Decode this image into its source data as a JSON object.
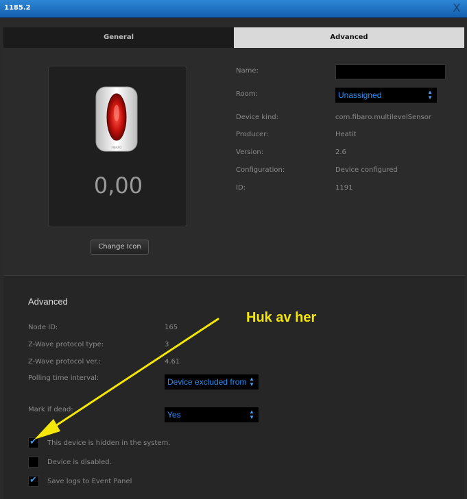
{
  "window": {
    "title": "1185.2",
    "close_glyph": "X"
  },
  "tabs": [
    {
      "label": "General",
      "active": false
    },
    {
      "label": "Advanced",
      "active": true
    }
  ],
  "device": {
    "value": "0,00",
    "brand_text": "FIBARO",
    "change_icon_label": "Change Icon"
  },
  "info": {
    "name_label": "Name:",
    "name_value": "",
    "room_label": "Room:",
    "room_value": "Unassigned",
    "device_kind_label": "Device kind:",
    "device_kind_value": "com.fibaro.multilevelSensor",
    "producer_label": "Producer:",
    "producer_value": "Heatit",
    "version_label": "Version:",
    "version_value": "2.6",
    "configuration_label": "Configuration:",
    "configuration_value": "Device configured",
    "id_label": "ID:",
    "id_value": "1191"
  },
  "advanced": {
    "title": "Advanced",
    "node_id_label": "Node ID:",
    "node_id_value": "165",
    "zwave_type_label": "Z-Wave protocol type:",
    "zwave_type_value": "3",
    "zwave_ver_label": "Z-Wave protocol ver.:",
    "zwave_ver_value": "4.61",
    "polling_label": "Polling time interval:",
    "polling_value": "Device excluded from",
    "mark_dead_label": "Mark if dead:",
    "mark_dead_value": "Yes",
    "checkboxes": [
      {
        "label": "This device is hidden in the system.",
        "checked": true
      },
      {
        "label": "Device is disabled.",
        "checked": false
      },
      {
        "label": "Save logs to Event Panel",
        "checked": true
      }
    ]
  },
  "annotation": {
    "text": "Huk av her",
    "color": "#f5e60a"
  },
  "colors": {
    "accent_blue": "#2e8df0",
    "titlebar": "#1e6fc0"
  }
}
